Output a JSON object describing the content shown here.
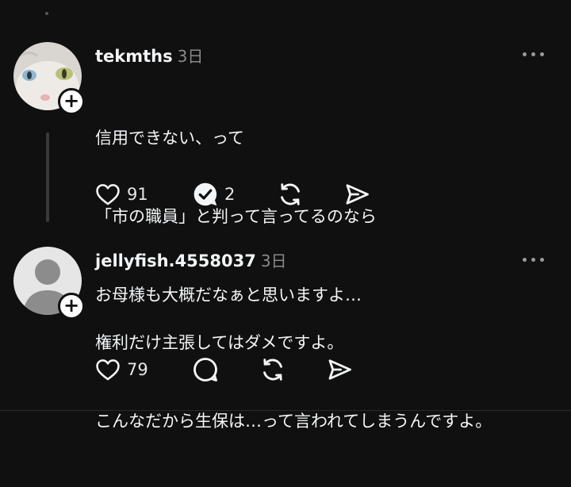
{
  "posts": [
    {
      "username": "tekmths",
      "time": "3日",
      "lines": [
        "信用できない、って",
        "「市の職員」と判って言ってるのなら",
        "お母様も大概だなぁと思いますよ…"
      ],
      "likes": "91",
      "replies": "2"
    },
    {
      "username": "jellyfish.4558037",
      "time": "3日",
      "lines": [
        "権利だけ主張してはダメですよ。",
        "こんなだから生保は…って言われてしまうんですよ。"
      ],
      "likes": "79",
      "replies": ""
    }
  ],
  "icons": {
    "like": "heart-icon",
    "reply_answered": "reply-check-icon",
    "reply": "reply-icon",
    "repost": "repost-icon",
    "share": "share-icon",
    "more": "more-icon",
    "follow": "plus-icon"
  },
  "colors": {
    "background": "#101010",
    "text": "#f3f5f7",
    "muted": "#8a8a8a"
  }
}
